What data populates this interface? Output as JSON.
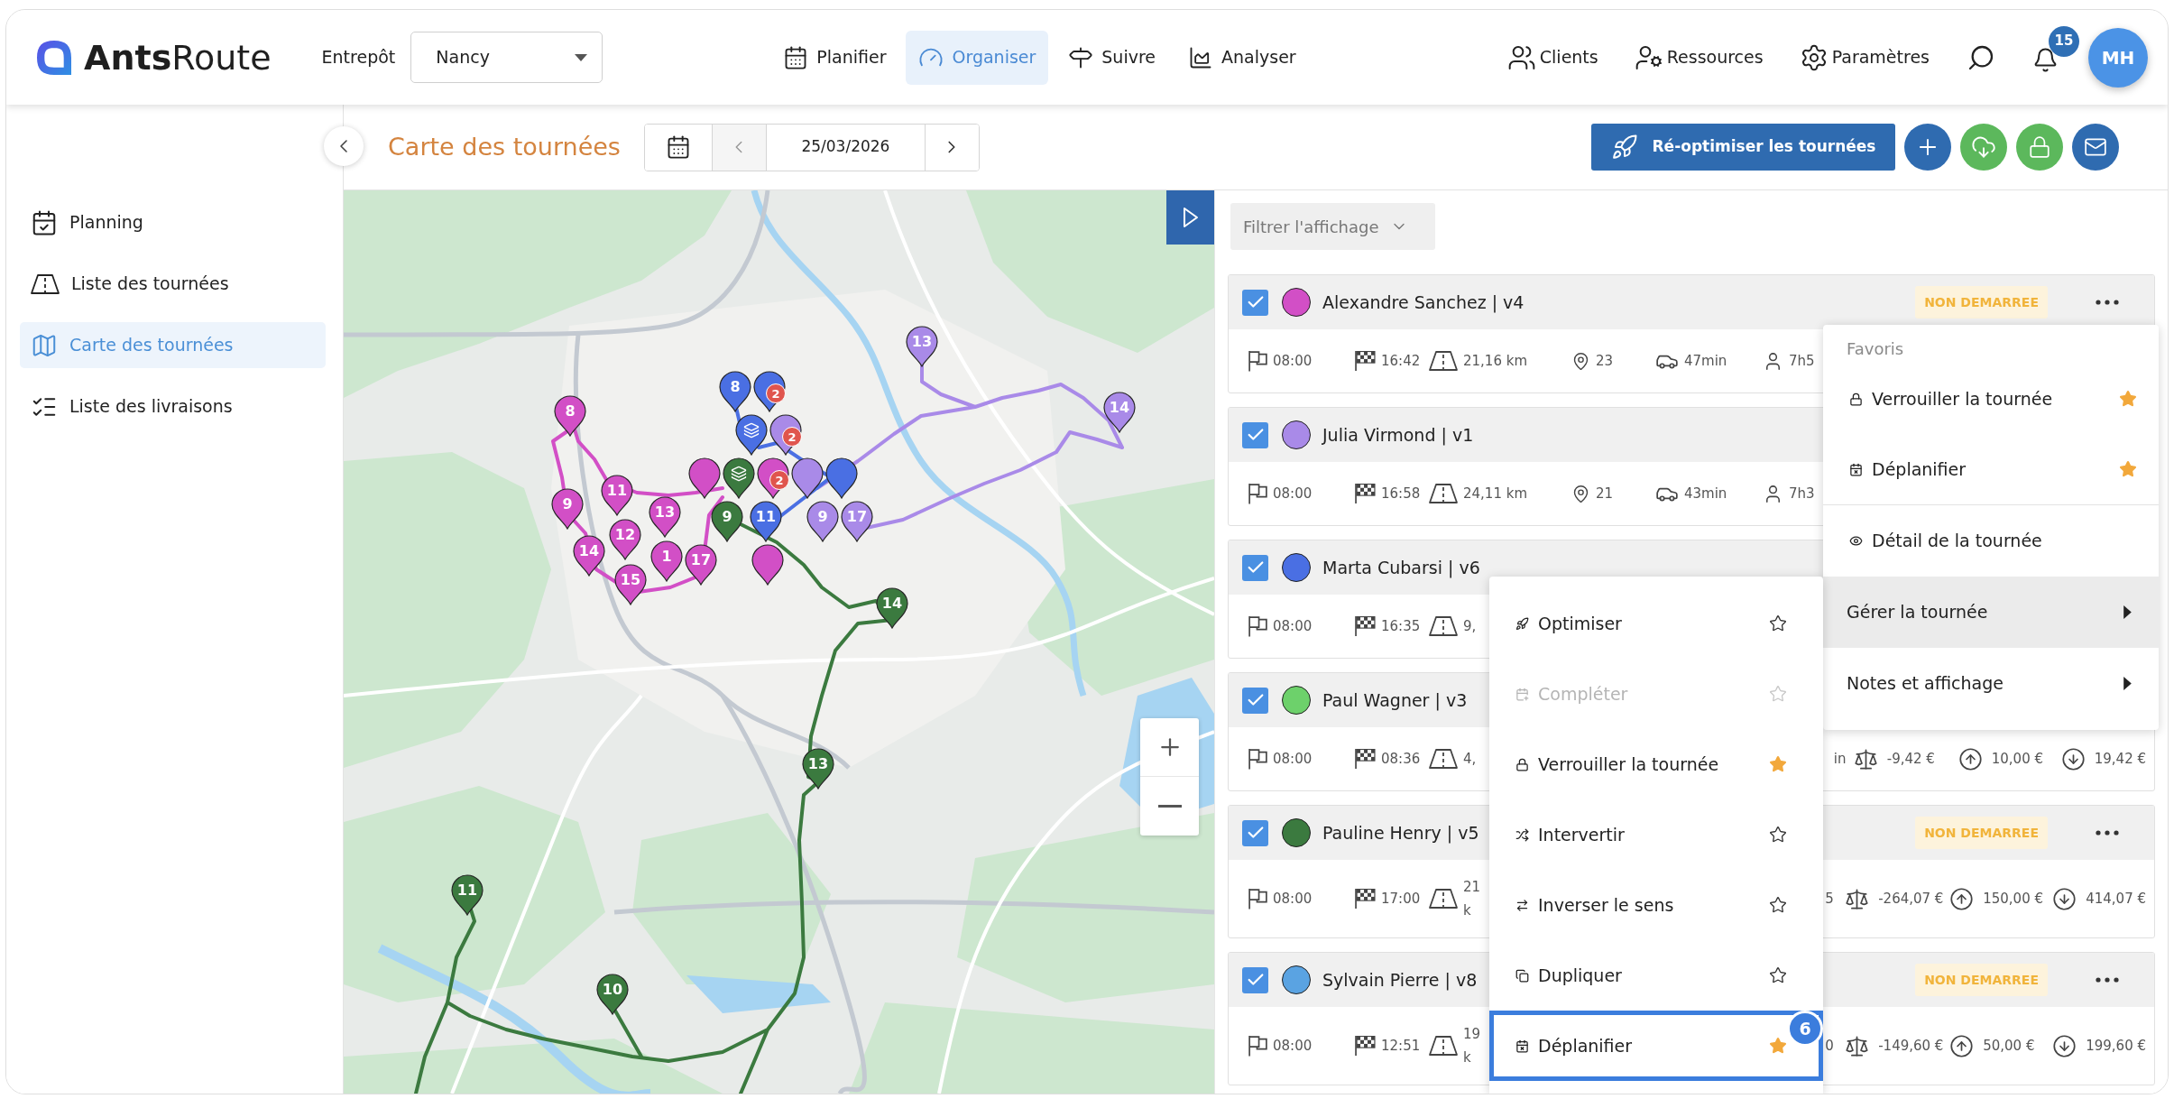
{
  "header": {
    "logo": "**Ants**Route",
    "warehouse_label": "Entrepôt",
    "warehouse": "Nancy",
    "nav": [
      {
        "label": "Planifier",
        "selected": false
      },
      {
        "label": "Organiser",
        "selected": true
      },
      {
        "label": "Suivre",
        "selected": false
      },
      {
        "label": "Analyser",
        "selected": false
      }
    ],
    "links": [
      "Clients",
      "Ressources",
      "Paramètres"
    ],
    "notification_count": "15",
    "avatar": "MH"
  },
  "sidebar": {
    "items": [
      {
        "label": "Planning",
        "selected": false
      },
      {
        "label": "Liste des tournées",
        "selected": false
      },
      {
        "label": "Carte des tournées",
        "selected": true
      },
      {
        "label": "Liste des livraisons",
        "selected": false
      }
    ]
  },
  "toolbar": {
    "title": "Carte des tournées",
    "date": "25/03/2026",
    "optimize_button": "Ré-optimiser les tournées"
  },
  "map": {
    "markers": [
      {
        "kind": "plain",
        "color": "#d24fc6"
      },
      {
        "kind": "plain",
        "color": "#4a6fe3",
        "badge": "2"
      },
      {
        "kind": "plain",
        "color": "#a98ae8",
        "badge": "2"
      },
      {
        "kind": "plain",
        "color": "#d24fc6",
        "badge": "2"
      },
      {
        "kind": "plain",
        "color": "#a98ae8"
      },
      {
        "kind": "plain",
        "color": "#4a6fe3"
      },
      {
        "kind": "plain",
        "color": "#d24fc6"
      },
      {
        "kind": "stack",
        "color": "#4a6fe3"
      },
      {
        "kind": "stack",
        "color": "#3b7a3f"
      },
      {
        "kind": "number",
        "label": "8",
        "color": "#d24fc6"
      },
      {
        "kind": "number",
        "label": "9",
        "color": "#d24fc6"
      },
      {
        "kind": "number",
        "label": "11",
        "color": "#d24fc6"
      },
      {
        "kind": "number",
        "label": "12",
        "color": "#d24fc6"
      },
      {
        "kind": "number",
        "label": "13",
        "color": "#d24fc6"
      },
      {
        "kind": "number",
        "label": "14",
        "color": "#d24fc6"
      },
      {
        "kind": "number",
        "label": "15",
        "color": "#d24fc6"
      },
      {
        "kind": "number",
        "label": "1",
        "color": "#d24fc6"
      },
      {
        "kind": "number",
        "label": "17",
        "color": "#d24fc6"
      },
      {
        "kind": "number",
        "label": "13",
        "color": "#a98ae8"
      },
      {
        "kind": "number",
        "label": "14",
        "color": "#a98ae8"
      },
      {
        "kind": "number",
        "label": "8",
        "color": "#4a6fe3"
      },
      {
        "kind": "number",
        "label": "9",
        "color": "#3b7a3f"
      },
      {
        "kind": "number",
        "label": "11",
        "color": "#4a6fe3"
      },
      {
        "kind": "number",
        "label": "9",
        "color": "#a98ae8"
      },
      {
        "kind": "number",
        "label": "17",
        "color": "#a98ae8"
      },
      {
        "kind": "number",
        "label": "14",
        "color": "#3b7a3f"
      },
      {
        "kind": "number",
        "label": "13",
        "color": "#3b7a3f"
      },
      {
        "kind": "number",
        "label": "11",
        "color": "#3b7a3f"
      },
      {
        "kind": "number",
        "label": "10",
        "color": "#3b7a3f"
      }
    ]
  },
  "panel": {
    "filter": "Filtrer l'affichage",
    "routes": [
      {
        "name": "Alexandre Sanchez | v4",
        "color": "#d24fc6",
        "checked": true,
        "status": "NON DEMARREE",
        "menu_button": true,
        "stats": [
          {
            "kind": "start",
            "text": "08:00"
          },
          {
            "kind": "end",
            "text": "16:42"
          },
          {
            "kind": "distance",
            "text": "21,16 km"
          },
          {
            "kind": "stops",
            "text": "23"
          },
          {
            "kind": "drive",
            "text": "47min"
          },
          {
            "kind": "driver",
            "text": "7h5"
          }
        ]
      },
      {
        "name": "Julia Virmond | v1",
        "color": "#a98ae8",
        "checked": true,
        "menu_button": false,
        "stats": [
          {
            "kind": "start",
            "text": "08:00"
          },
          {
            "kind": "end",
            "text": "16:58"
          },
          {
            "kind": "distance",
            "text": "24,11 km"
          },
          {
            "kind": "stops",
            "text": "21"
          },
          {
            "kind": "drive",
            "text": "43min"
          },
          {
            "kind": "driver",
            "text": "7h3"
          }
        ]
      },
      {
        "name": "Marta Cubarsi | v6",
        "color": "#4a6fe3",
        "checked": true,
        "menu_button": false,
        "stats": [
          {
            "kind": "start",
            "text": "08:00"
          },
          {
            "kind": "end",
            "text": "16:35"
          },
          {
            "kind": "distance",
            "text": "9,"
          }
        ]
      },
      {
        "name": "Paul Wagner | v3",
        "color": "#6dd16b",
        "checked": true,
        "menu_button": false,
        "stats": [
          {
            "kind": "start",
            "text": "08:00"
          },
          {
            "kind": "end",
            "text": "08:36"
          },
          {
            "kind": "distance",
            "text": "4,"
          }
        ],
        "totals": [
          {
            "kind": "fragment",
            "text": "in"
          },
          {
            "kind": "balance",
            "text": "-9,42 €"
          },
          {
            "kind": "income",
            "text": "10,00 €"
          },
          {
            "kind": "expense",
            "text": "19,42 €"
          }
        ]
      },
      {
        "name": "Pauline Henry | v5",
        "color": "#3b7a3f",
        "checked": true,
        "status": "NON DEMARREE",
        "menu_button": true,
        "stats": [
          {
            "kind": "start",
            "text": "08:00"
          },
          {
            "kind": "end",
            "text": "17:00"
          },
          {
            "kind": "distance",
            "text": "21\nk"
          }
        ],
        "totals": [
          {
            "kind": "fragment",
            "text": "5"
          },
          {
            "kind": "balance",
            "text": "-264,07 €"
          },
          {
            "kind": "income",
            "text": "150,00 €"
          },
          {
            "kind": "expense",
            "text": "414,07 €"
          }
        ]
      },
      {
        "name": "Sylvain Pierre | v8",
        "color": "#5aa3e2",
        "checked": true,
        "status": "NON DEMARREE",
        "menu_button": true,
        "stats": [
          {
            "kind": "start",
            "text": "08:00"
          },
          {
            "kind": "end",
            "text": "12:51"
          },
          {
            "kind": "distance",
            "text": "19\nk"
          }
        ],
        "totals": [
          {
            "kind": "fragment",
            "text": "0"
          },
          {
            "kind": "balance",
            "text": "-149,60 €"
          },
          {
            "kind": "income",
            "text": "50,00 €"
          },
          {
            "kind": "expense",
            "text": "199,60 €"
          }
        ]
      }
    ],
    "menu": {
      "title": "Favoris",
      "favorites": [
        {
          "label": "Verrouiller la tournée",
          "starred": true
        },
        {
          "label": "Déplanifier",
          "starred": true
        }
      ],
      "items": [
        {
          "kind": "action",
          "label": "Détail de la tournée"
        },
        {
          "kind": "submenu",
          "label": "Gérer la tournée",
          "expanded": true
        },
        {
          "kind": "submenu",
          "label": "Notes et affichage",
          "expanded": false
        }
      ]
    },
    "submenu": {
      "items": [
        {
          "label": "Optimiser",
          "starred": false,
          "disabled": false,
          "highlighted": false
        },
        {
          "label": "Compléter",
          "starred": false,
          "disabled": true,
          "highlighted": false
        },
        {
          "label": "Verrouiller la tournée",
          "starred": true,
          "disabled": false,
          "highlighted": false
        },
        {
          "label": "Intervertir",
          "starred": false,
          "disabled": false,
          "highlighted": false
        },
        {
          "label": "Inverser le sens",
          "starred": false,
          "disabled": false,
          "highlighted": false
        },
        {
          "label": "Dupliquer",
          "starred": false,
          "disabled": false,
          "highlighted": false
        },
        {
          "label": "Déplanifier",
          "starred": true,
          "disabled": false,
          "highlighted": true,
          "step": "6"
        }
      ]
    }
  }
}
